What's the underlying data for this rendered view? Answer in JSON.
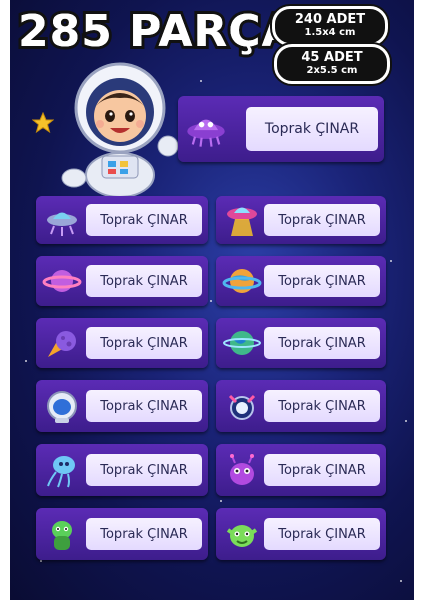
{
  "header": {
    "title": "285 PARÇA",
    "badges": [
      {
        "count": "240 ADET",
        "size": "1.5x4 cm"
      },
      {
        "count": "45 ADET",
        "size": "2x5.5 cm"
      }
    ]
  },
  "label_name": "Toprak ÇINAR",
  "labels": [
    {
      "icon": "alien-ufo-icon",
      "text": "Toprak ÇINAR"
    },
    {
      "icon": "ufo-icon",
      "text": "Toprak ÇINAR"
    },
    {
      "icon": "ufo-beam-icon",
      "text": "Toprak ÇINAR"
    },
    {
      "icon": "planet-ring-icon",
      "text": "Toprak ÇINAR"
    },
    {
      "icon": "planet-earth-icon",
      "text": "Toprak ÇINAR"
    },
    {
      "icon": "comet-icon",
      "text": "Toprak ÇINAR"
    },
    {
      "icon": "planet-green-icon",
      "text": "Toprak ÇINAR"
    },
    {
      "icon": "helmet-icon",
      "text": "Toprak ÇINAR"
    },
    {
      "icon": "satellite-icon",
      "text": "Toprak ÇINAR"
    },
    {
      "icon": "jellyfish-alien-icon",
      "text": "Toprak ÇINAR"
    },
    {
      "icon": "purple-alien-icon",
      "text": "Toprak ÇINAR"
    },
    {
      "icon": "green-alien-icon",
      "text": "Toprak ÇINAR"
    },
    {
      "icon": "green-monster-icon",
      "text": "Toprak ÇINAR"
    }
  ],
  "colors": {
    "label_bg": "#4a22a0",
    "tag_bg": "#efe8ff",
    "text": "#2a2a55"
  }
}
